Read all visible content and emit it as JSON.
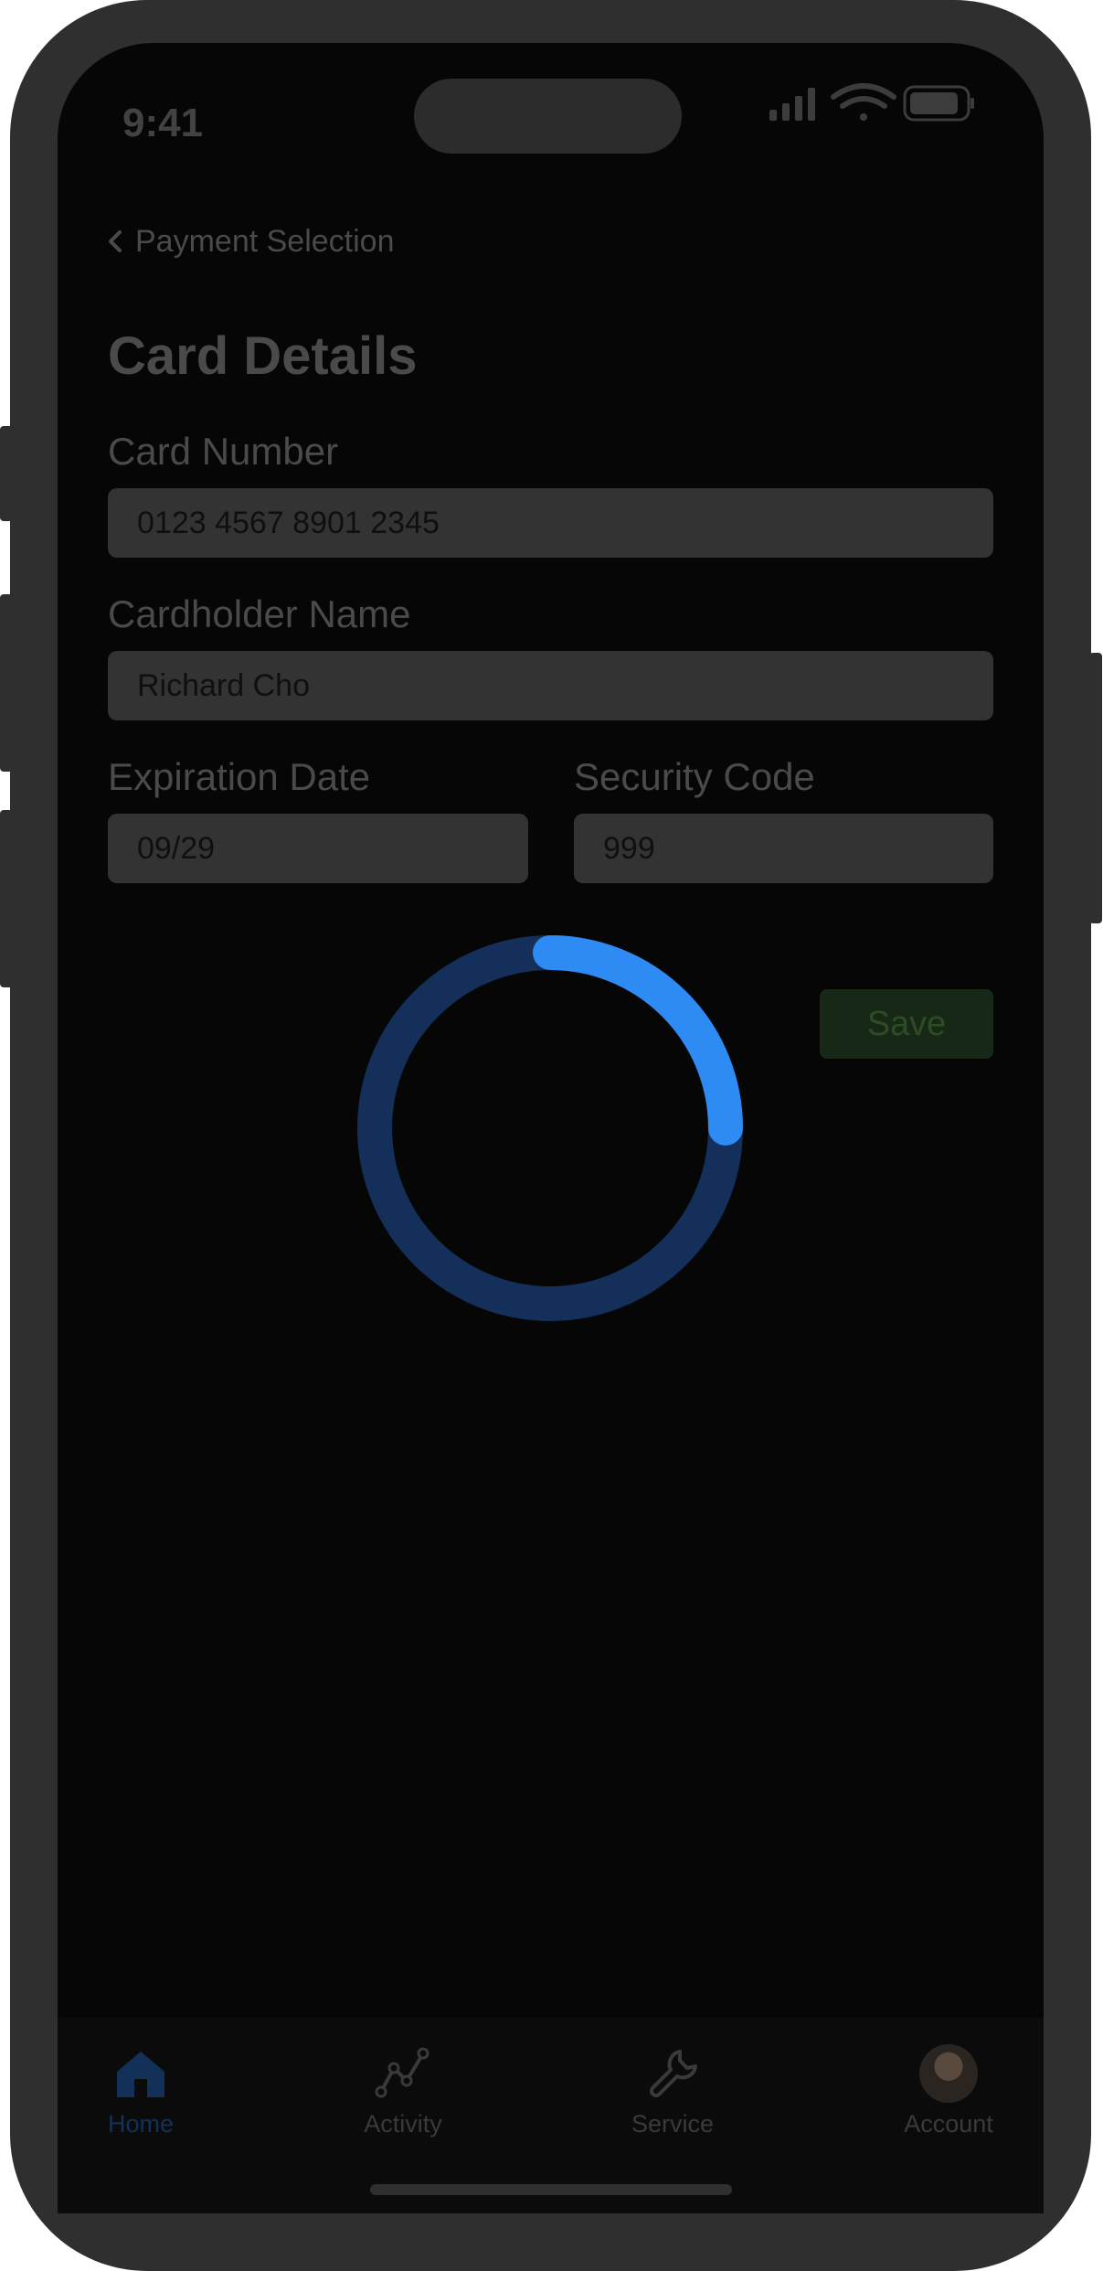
{
  "status_bar": {
    "time": "9:41"
  },
  "nav": {
    "back_label": "Payment Selection"
  },
  "title": "Card Details",
  "form": {
    "card_number": {
      "label": "Card Number",
      "value": "0123 4567 8901 2345"
    },
    "cardholder_name": {
      "label": "Cardholder Name",
      "value": "Richard Cho"
    },
    "expiration_date": {
      "label": "Expiration Date",
      "value": "09/29"
    },
    "security_code": {
      "label": "Security Code",
      "value": "999"
    }
  },
  "save_button": {
    "label": "Save"
  },
  "loading": {
    "progress": 0.25,
    "color": "#2d8bf3"
  },
  "tab_bar": {
    "tabs": [
      {
        "label": "Home",
        "icon": "home-icon",
        "active": true
      },
      {
        "label": "Activity",
        "icon": "activity-icon",
        "active": false
      },
      {
        "label": "Service",
        "icon": "wrench-icon",
        "active": false
      },
      {
        "label": "Account",
        "icon": "avatar",
        "active": false
      }
    ]
  }
}
